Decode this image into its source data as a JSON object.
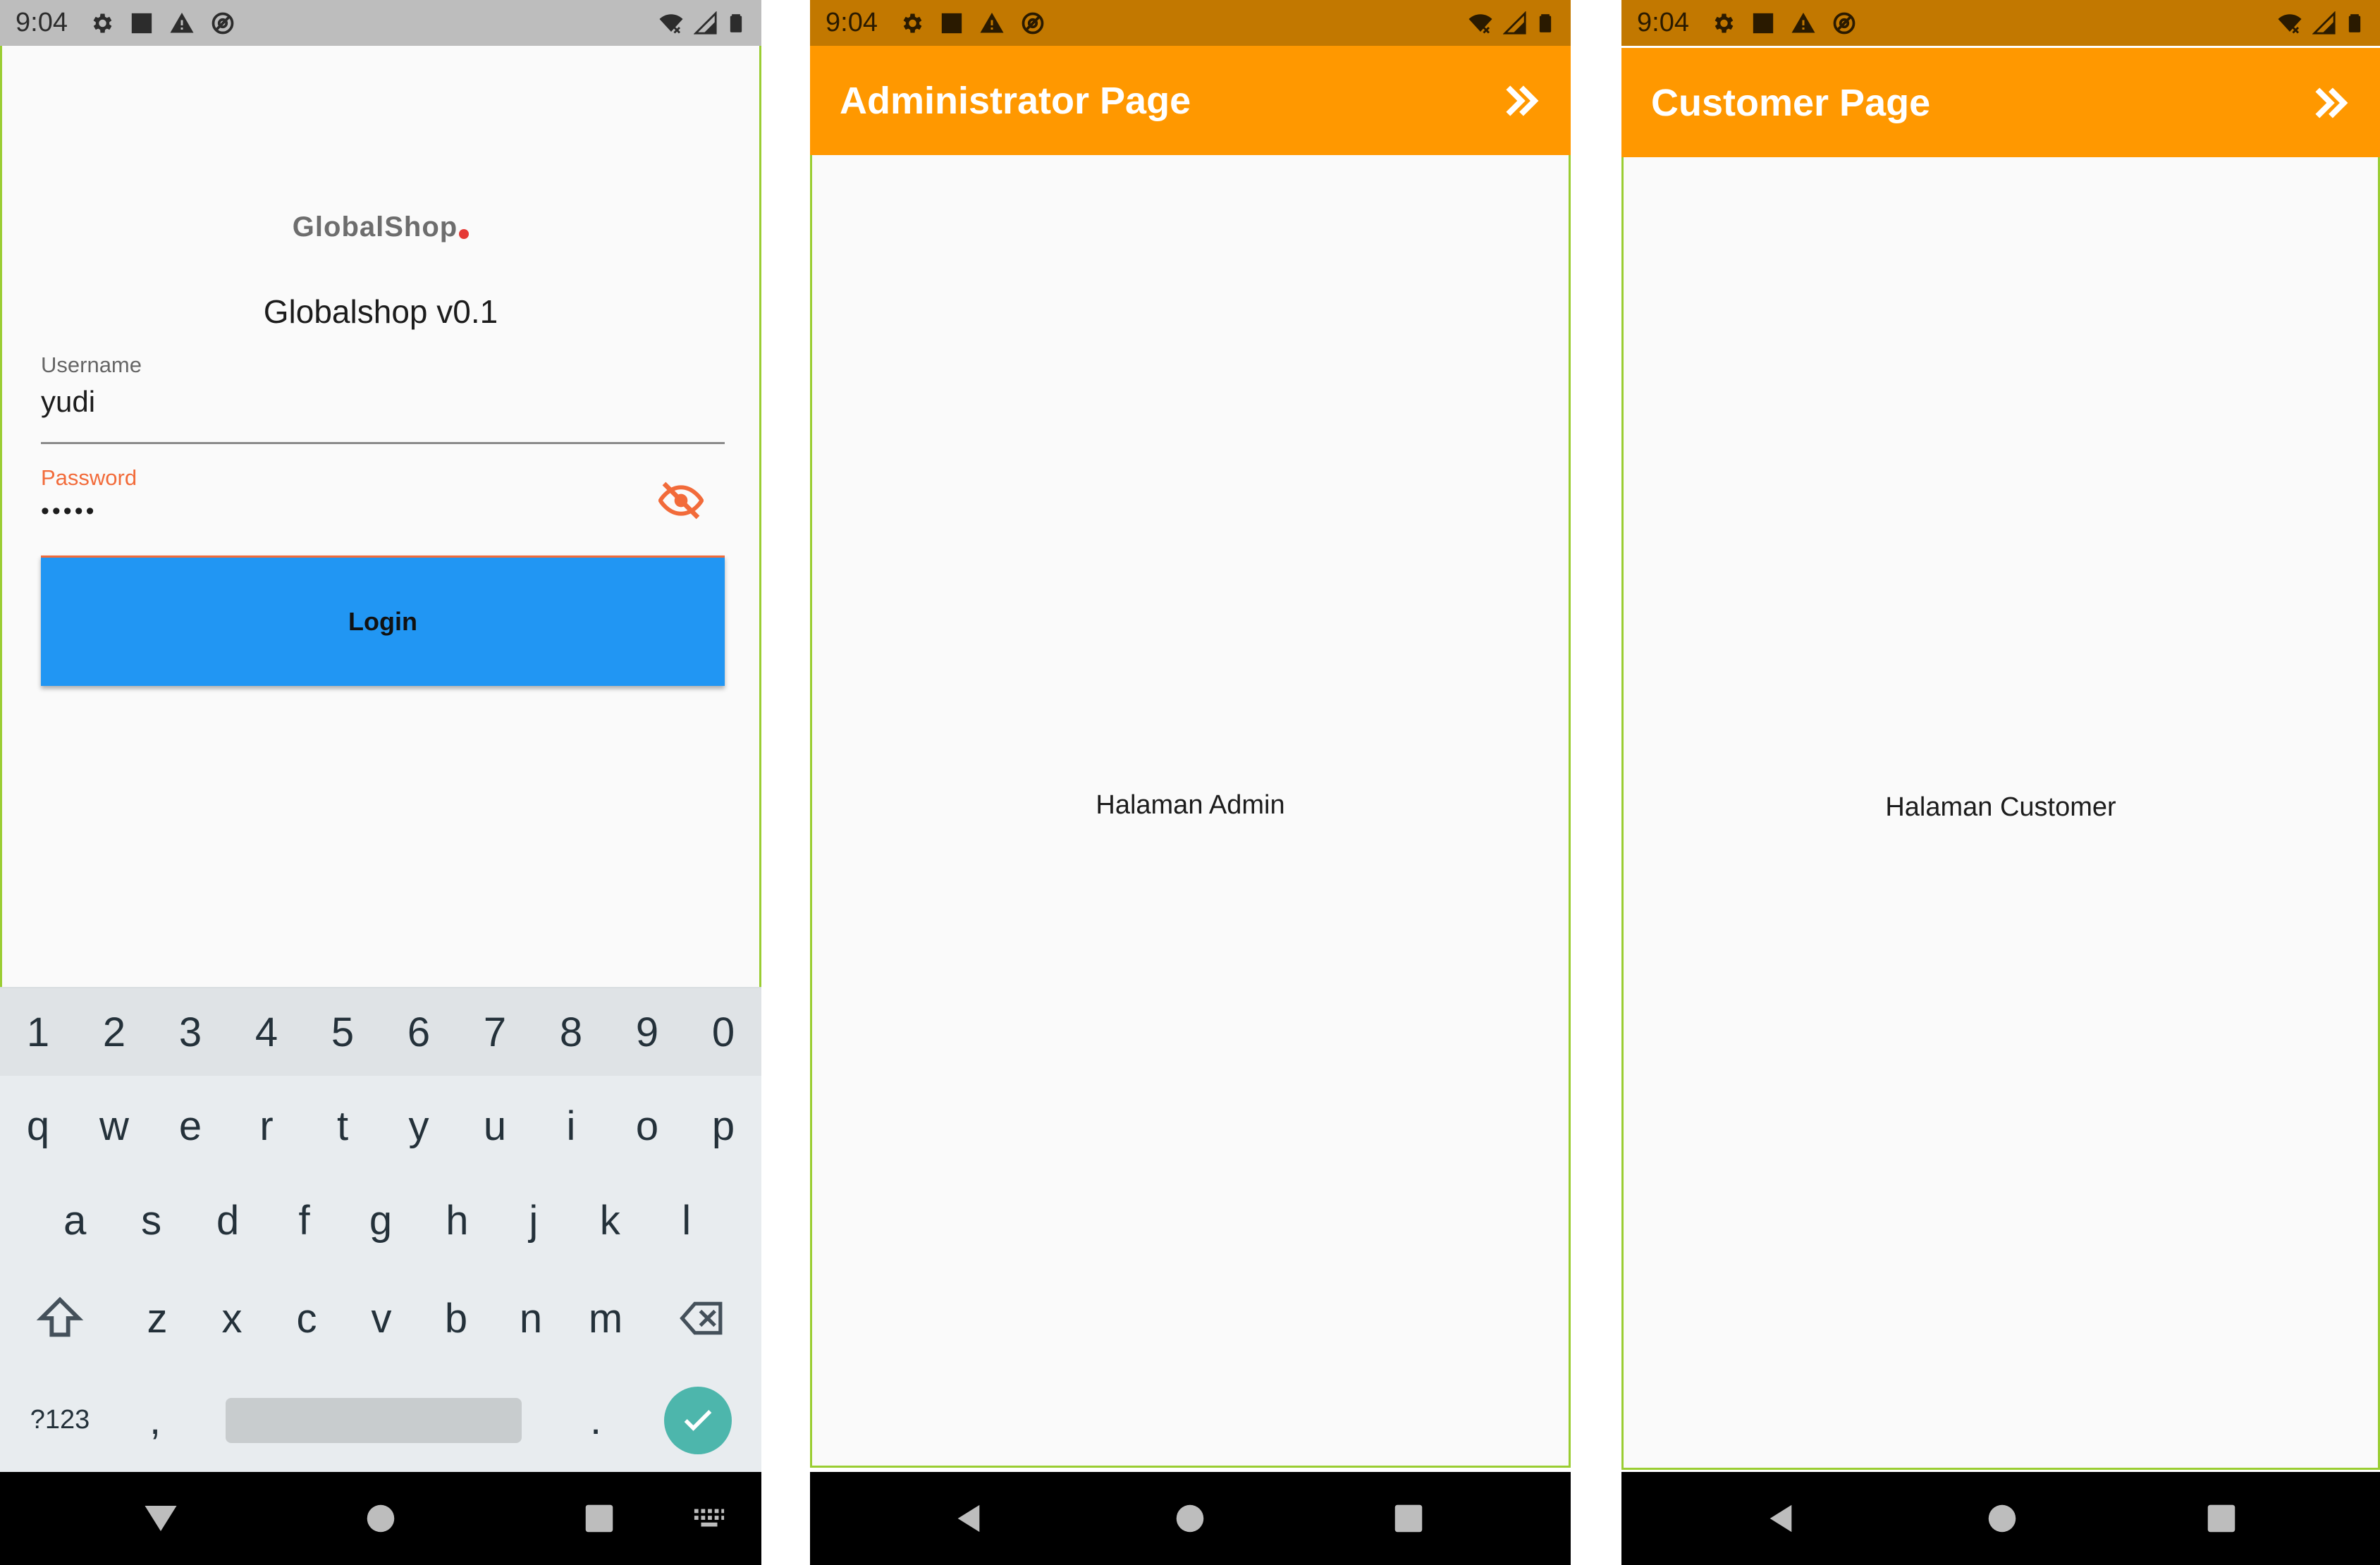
{
  "colors": {
    "accent_blue": "#2196f3",
    "app_bar_orange": "#ff9800",
    "status_orange": "#c27800",
    "error_orange": "#f26b3a",
    "keyboard_done": "#4db6ac"
  },
  "login_screen": {
    "status_bar": {
      "time": "9:04"
    },
    "logo": {
      "text": "GlobalShop"
    },
    "app_version": "Globalshop v0.1",
    "username": {
      "label": "Username",
      "value": "yudi"
    },
    "password": {
      "label": "Password",
      "value": "•••••",
      "toggle_icon": "visibility-off-icon"
    },
    "login_button": "Login",
    "keyboard": {
      "numbers": [
        "1",
        "2",
        "3",
        "4",
        "5",
        "6",
        "7",
        "8",
        "9",
        "0"
      ],
      "row1": [
        "q",
        "w",
        "e",
        "r",
        "t",
        "y",
        "u",
        "i",
        "o",
        "p"
      ],
      "row2": [
        "a",
        "s",
        "d",
        "f",
        "g",
        "h",
        "j",
        "k",
        "l"
      ],
      "row3": [
        "z",
        "x",
        "c",
        "v",
        "b",
        "n",
        "m"
      ],
      "symbols_key": "?123",
      "comma_key": ",",
      "period_key": "."
    }
  },
  "admin_screen": {
    "status_bar": {
      "time": "9:04"
    },
    "app_bar_title": "Administrator Page",
    "body_text": "Halaman Admin"
  },
  "customer_screen": {
    "status_bar": {
      "time": "9:04"
    },
    "app_bar_title": "Customer Page",
    "body_text": "Halaman Customer"
  }
}
